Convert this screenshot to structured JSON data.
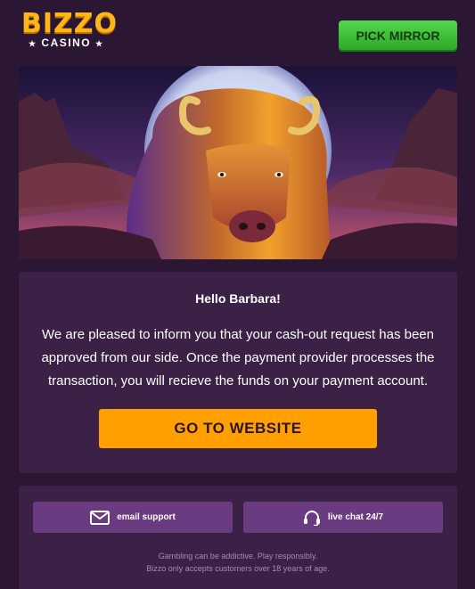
{
  "logo": {
    "top": "BIZZO",
    "bottom": "CASINO"
  },
  "header": {
    "mirror_label": "PICK MIRROR"
  },
  "message": {
    "greeting": "Hello Barbara!",
    "body": "We are pleased to inform you that your cash-out request has been approved from our side. Once the payment provider processes the transaction, you will recieve the funds on your payment account.",
    "cta_label": "GO TO WEBSITE"
  },
  "footer": {
    "email_label": "email support",
    "chat_label": "live chat 24/7",
    "disclaimer_line1": "Gambling can be addictive. Play responsibly.",
    "disclaimer_line2": "Bizzo only accepts customers over 18 years of age."
  },
  "colors": {
    "background": "#2b1734",
    "card": "#3a2145",
    "accent": "#ffa000",
    "mirror_button": "#3ec43a",
    "support_button": "#6a3b80"
  },
  "icons": {
    "email": "envelope-icon",
    "chat": "headset-icon"
  }
}
